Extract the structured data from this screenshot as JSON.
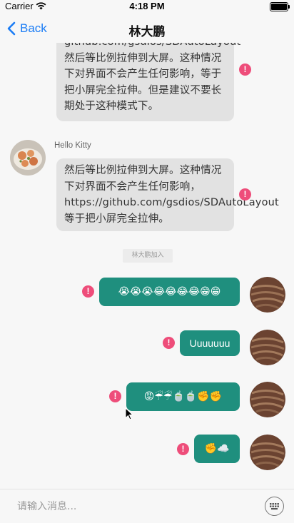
{
  "status_bar": {
    "carrier": "Carrier",
    "time": "4:18 PM"
  },
  "nav": {
    "back_label": "Back",
    "title": "林大鹏"
  },
  "messages": [
    {
      "type": "incoming",
      "text": "github.com/gsdios/SDAutoLayout然后等比例拉伸到大屏。这种情况下对界面不会产生任何影响，等于把小屏完全拉伸。但是建议不要长期处于这种模式下。",
      "failed": true
    },
    {
      "type": "incoming",
      "sender": "Hello Kitty",
      "text": "然后等比例拉伸到大屏。这种情况下对界面不会产生任何影响，https://github.com/gsdios/SDAutoLayout等于把小屏完全拉伸。",
      "failed": true
    },
    {
      "type": "system",
      "text": "林大鹏加入"
    },
    {
      "type": "outgoing",
      "text": "😭😭😭😂😂😂😂😁😁",
      "failed": true
    },
    {
      "type": "outgoing",
      "text": "Uuuuuuu",
      "failed": true
    },
    {
      "type": "outgoing",
      "text": "😡☔☔🍵🍵✊✊",
      "failed": true
    },
    {
      "type": "outgoing",
      "text": "✊☁️",
      "failed": true
    }
  ],
  "input": {
    "placeholder": "请输入消息..."
  },
  "colors": {
    "accent": "#1a7cf5",
    "outgoing_bubble": "#1f8f7e",
    "incoming_bubble": "#e2e2e2",
    "failed_badge": "#ee4d7a"
  },
  "icons": {
    "back": "chevron-left-icon",
    "wifi": "wifi-icon",
    "battery": "battery-icon",
    "failed": "exclamation-icon",
    "keyboard": "keyboard-icon",
    "cursor": "mouse-pointer-icon"
  }
}
